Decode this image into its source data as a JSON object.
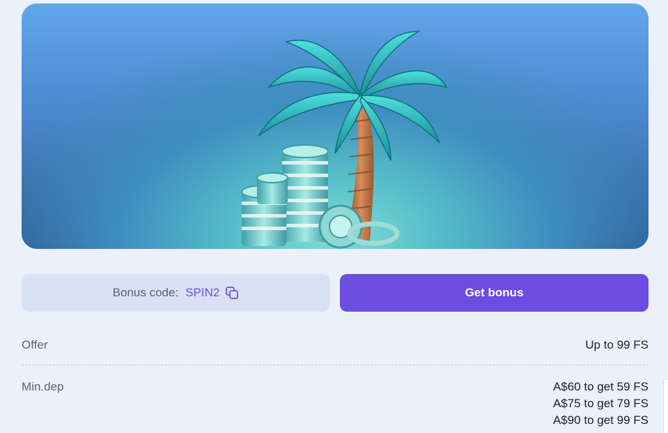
{
  "banner": {
    "image": "palm-tree-with-casino-chip-stacks"
  },
  "bonus_code": {
    "label": "Bonus code:",
    "value": "SPIN2",
    "copy_icon": "copy-icon"
  },
  "get_bonus": {
    "label": "Get bonus"
  },
  "details": {
    "offer": {
      "label": "Offer",
      "value": "Up to 99 FS"
    },
    "min_dep": {
      "label": "Min.dep",
      "values": [
        "A$60 to get 59 FS",
        "A$75 to get 79 FS",
        "A$90 to get 99 FS"
      ]
    }
  },
  "colors": {
    "accent": "#6b4de2",
    "code_text": "#6a4fe0",
    "page_background": "#ecf0fb",
    "code_box": "#d9e1f4"
  }
}
